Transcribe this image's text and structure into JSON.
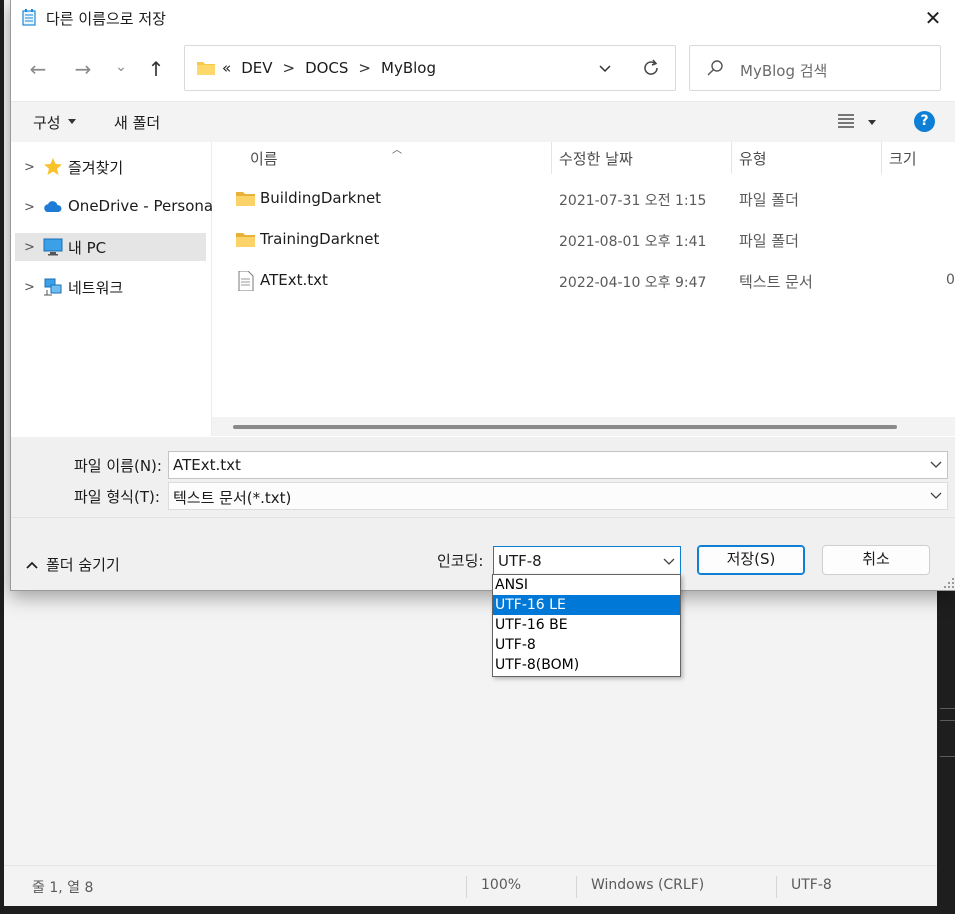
{
  "dialog": {
    "title": "다른 이름으로 저장",
    "close_glyph": "✕"
  },
  "nav": {
    "back_glyph": "←",
    "forward_glyph": "→",
    "recent_glyph": "⌄",
    "up_glyph": "↑"
  },
  "address": {
    "overflow": "«",
    "crumbs": [
      "DEV",
      "DOCS",
      "MyBlog"
    ],
    "sep": ">"
  },
  "search": {
    "placeholder": "MyBlog 검색"
  },
  "commandbar": {
    "organize": "구성",
    "new_folder": "새 폴더",
    "help": "?"
  },
  "navpane": {
    "items": [
      {
        "label": "즐겨찾기",
        "icon": "star-icon"
      },
      {
        "label": "OneDrive - Personal",
        "icon": "cloud-icon"
      },
      {
        "label": "내 PC",
        "icon": "monitor-icon",
        "selected": true
      },
      {
        "label": "네트워크",
        "icon": "network-icon"
      }
    ],
    "chevron": ">"
  },
  "filelist": {
    "columns": [
      "이름",
      "수정한 날짜",
      "유형",
      "크기"
    ],
    "rows": [
      {
        "name": "BuildingDarknet",
        "date": "2021-07-31 오전 1:15",
        "type": "파일 폴더",
        "size": "",
        "icon": "folder-icon"
      },
      {
        "name": "TrainingDarknet",
        "date": "2021-08-01 오후 1:41",
        "type": "파일 폴더",
        "size": "",
        "icon": "folder-icon"
      },
      {
        "name": "ATExt.txt",
        "date": "2022-04-10 오후 9:47",
        "type": "텍스트 문서",
        "size": "0",
        "icon": "text-file-icon"
      }
    ]
  },
  "form": {
    "filename_label": "파일 이름(N):",
    "filename_value": "ATExt.txt",
    "filetype_label": "파일 형식(T):",
    "filetype_value": "텍스트 문서(*.txt)",
    "hide_folders": "폴더 숨기기",
    "encoding_label": "인코딩:",
    "encoding_value": "UTF-8",
    "encoding_options": [
      "ANSI",
      "UTF-16 LE",
      "UTF-16 BE",
      "UTF-8",
      "UTF-8(BOM)"
    ],
    "encoding_highlighted": "UTF-16 LE",
    "save": "저장(S)",
    "cancel": "취소"
  },
  "statusbar": {
    "position": "줄 1, 열 8",
    "zoom": "100%",
    "line_ending": "Windows (CRLF)",
    "encoding": "UTF-8"
  },
  "colors": {
    "accent": "#0078d7",
    "folder": "#f7c948",
    "help_bg": "#0f7fd6"
  }
}
